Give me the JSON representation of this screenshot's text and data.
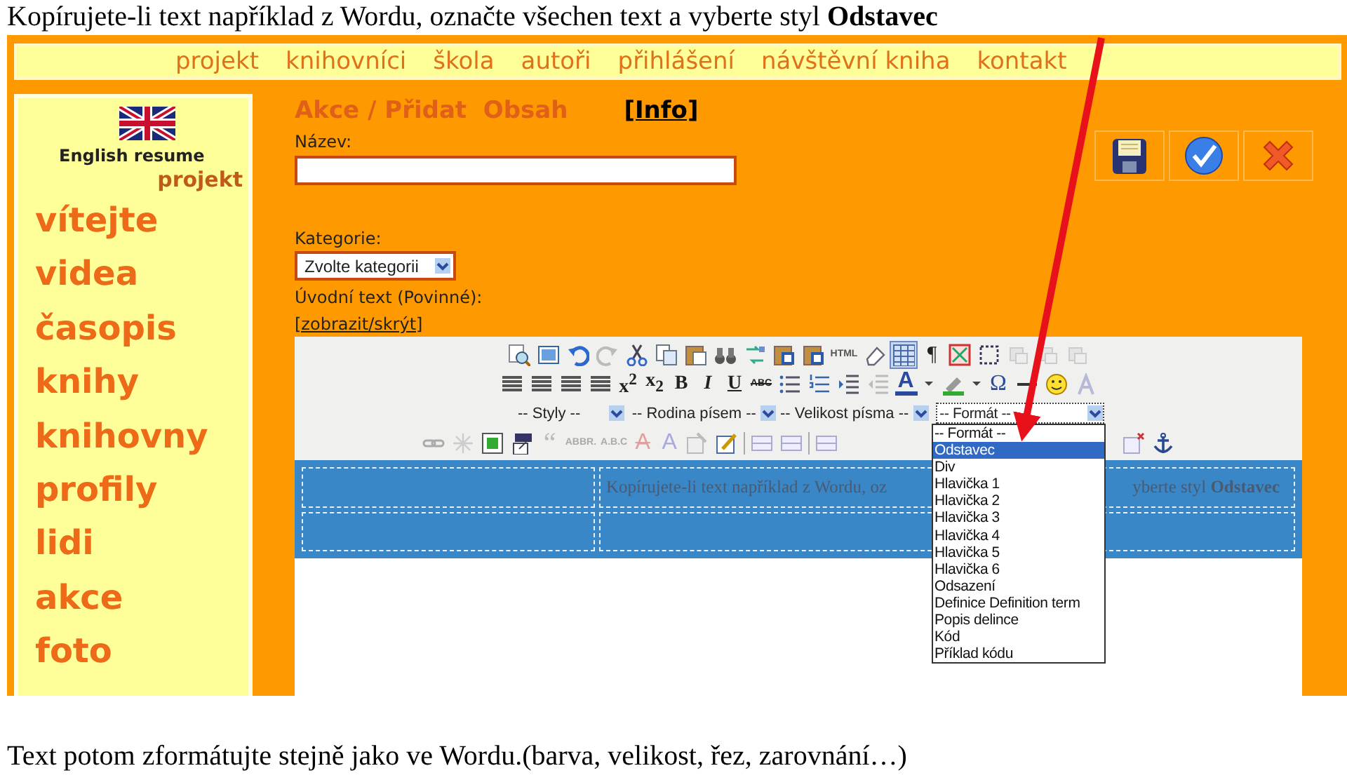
{
  "caption_top": "Kopírujete-li text například z Wordu, označte všechen text a vyberte styl **Odstavec**",
  "nav": [
    "projekt",
    "knihovníci",
    "škola",
    "autoři",
    "přihlášení",
    "návštěvní kniha",
    "kontakt"
  ],
  "sidebar": {
    "flag_label": "English resume",
    "project_link": "projekt",
    "items": [
      "vítejte",
      "videa",
      "časopis",
      "knihy",
      "knihovny",
      "profily",
      "lidi",
      "akce",
      "foto"
    ]
  },
  "page": {
    "title": "Akce / Přidat  Obsah",
    "info_link": "[Info]",
    "name_label": "Název:",
    "category_label": "Kategorie:",
    "category_value": "Zvolte kategorii",
    "intro_label": "Úvodní text (Povinné):",
    "toggle_link": "[zobrazit/skrýt]"
  },
  "editor": {
    "glyphs": [
      "HTML",
      "¶",
      "x$^{2}$",
      "x$_{2}$",
      "B",
      "I",
      "U",
      "ABC",
      "A",
      "Ω",
      "“",
      "ABBR.",
      "A.B.C",
      "A",
      "A"
    ],
    "selects": [
      {
        "value": "-- Styly --"
      },
      {
        "value": "-- Rodina písem --"
      },
      {
        "value": "-- Velikost písma --"
      },
      {
        "value": "-- Formát --"
      }
    ],
    "content_left": "Kopírujete-li text například z Wordu, oz",
    "content_right": "yberte styl **Odstavec**",
    "format_options": [
      {
        "label": "-- Formát --",
        "selected": false
      },
      {
        "label": "Odstavec",
        "selected": true
      },
      {
        "label": "Div",
        "selected": false
      },
      {
        "label": "Hlavička 1",
        "selected": false
      },
      {
        "label": "Hlavička 2",
        "selected": false
      },
      {
        "label": "Hlavička 3",
        "selected": false
      },
      {
        "label": "Hlavička 4",
        "selected": false
      },
      {
        "label": "Hlavička 5",
        "selected": false
      },
      {
        "label": "Hlavička 6",
        "selected": false
      },
      {
        "label": "Odsazení",
        "selected": false
      },
      {
        "label": "Definice Definition term",
        "selected": false
      },
      {
        "label": "Popis delince",
        "selected": false
      },
      {
        "label": "Kód",
        "selected": false
      },
      {
        "label": "Příklad kódu",
        "selected": false
      }
    ]
  },
  "caption_bottom": "Text potom zformátujte stejně jako ve Wordu.(barva, velikost, řez, zarovnání…)"
}
